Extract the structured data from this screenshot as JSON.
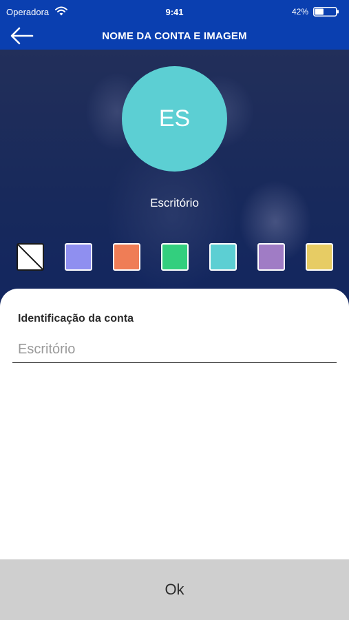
{
  "status_bar": {
    "carrier": "Operadora",
    "time": "9:41",
    "battery_percent": "42%",
    "battery_level": 0.42
  },
  "header": {
    "title": "NOME DA CONTA E IMAGEM",
    "back_icon": "arrow-left-icon"
  },
  "avatar": {
    "initials": "ES",
    "color": "#5ccfd3"
  },
  "account_name": "Escritório",
  "color_swatches": [
    {
      "name": "none",
      "color": "#ffffff"
    },
    {
      "name": "periwinkle",
      "color": "#8f8ff0"
    },
    {
      "name": "orange",
      "color": "#ef7d56"
    },
    {
      "name": "green",
      "color": "#33cf7e"
    },
    {
      "name": "turquoise",
      "color": "#5ccfd3"
    },
    {
      "name": "purple",
      "color": "#a07cc5"
    },
    {
      "name": "yellow",
      "color": "#e7cc64"
    }
  ],
  "form": {
    "label": "Identificação da conta",
    "placeholder": "Escritório",
    "value": ""
  },
  "ok_button": {
    "label": "Ok"
  },
  "colors": {
    "header_bg": "#0a3fb0",
    "ok_bg": "#cfcfcf"
  }
}
